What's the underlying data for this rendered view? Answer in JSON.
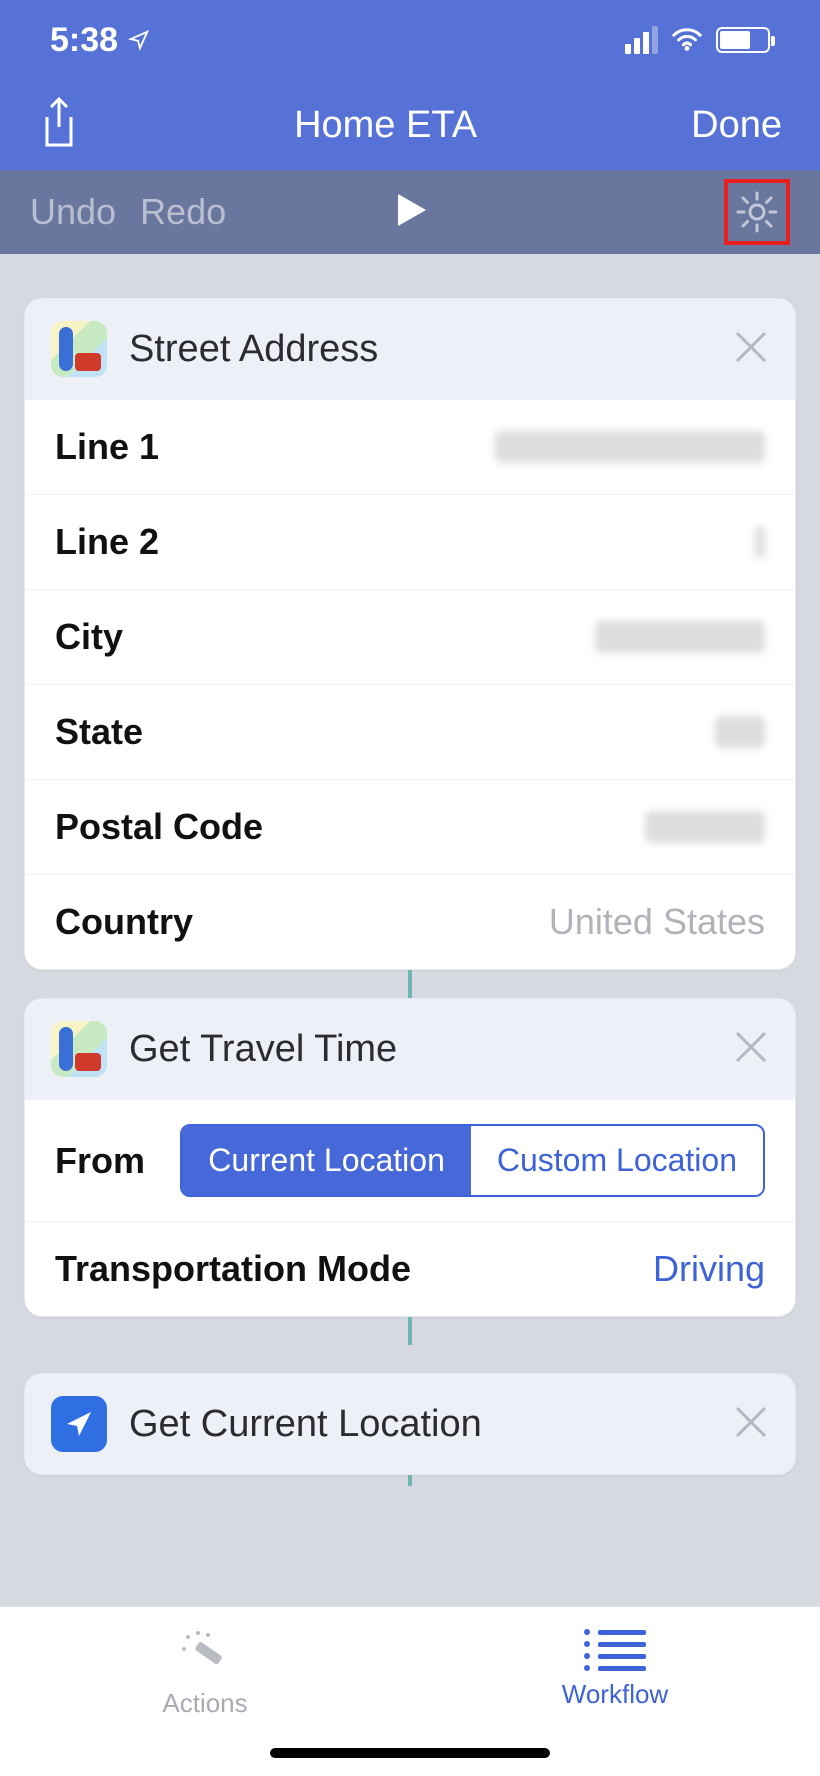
{
  "status": {
    "time": "5:38"
  },
  "nav": {
    "title": "Home ETA",
    "done": "Done"
  },
  "toolbar": {
    "undo": "Undo",
    "redo": "Redo"
  },
  "card1": {
    "title": "Street Address",
    "rows": {
      "line1": "Line 1",
      "line2": "Line 2",
      "city": "City",
      "state": "State",
      "postal": "Postal Code",
      "country_label": "Country",
      "country_value": "United States"
    }
  },
  "card2": {
    "title": "Get Travel Time",
    "from_label": "From",
    "seg_current": "Current Location",
    "seg_custom": "Custom Location",
    "mode_label": "Transportation Mode",
    "mode_value": "Driving"
  },
  "card3": {
    "title": "Get Current Location"
  },
  "tabs": {
    "actions": "Actions",
    "workflow": "Workflow"
  }
}
